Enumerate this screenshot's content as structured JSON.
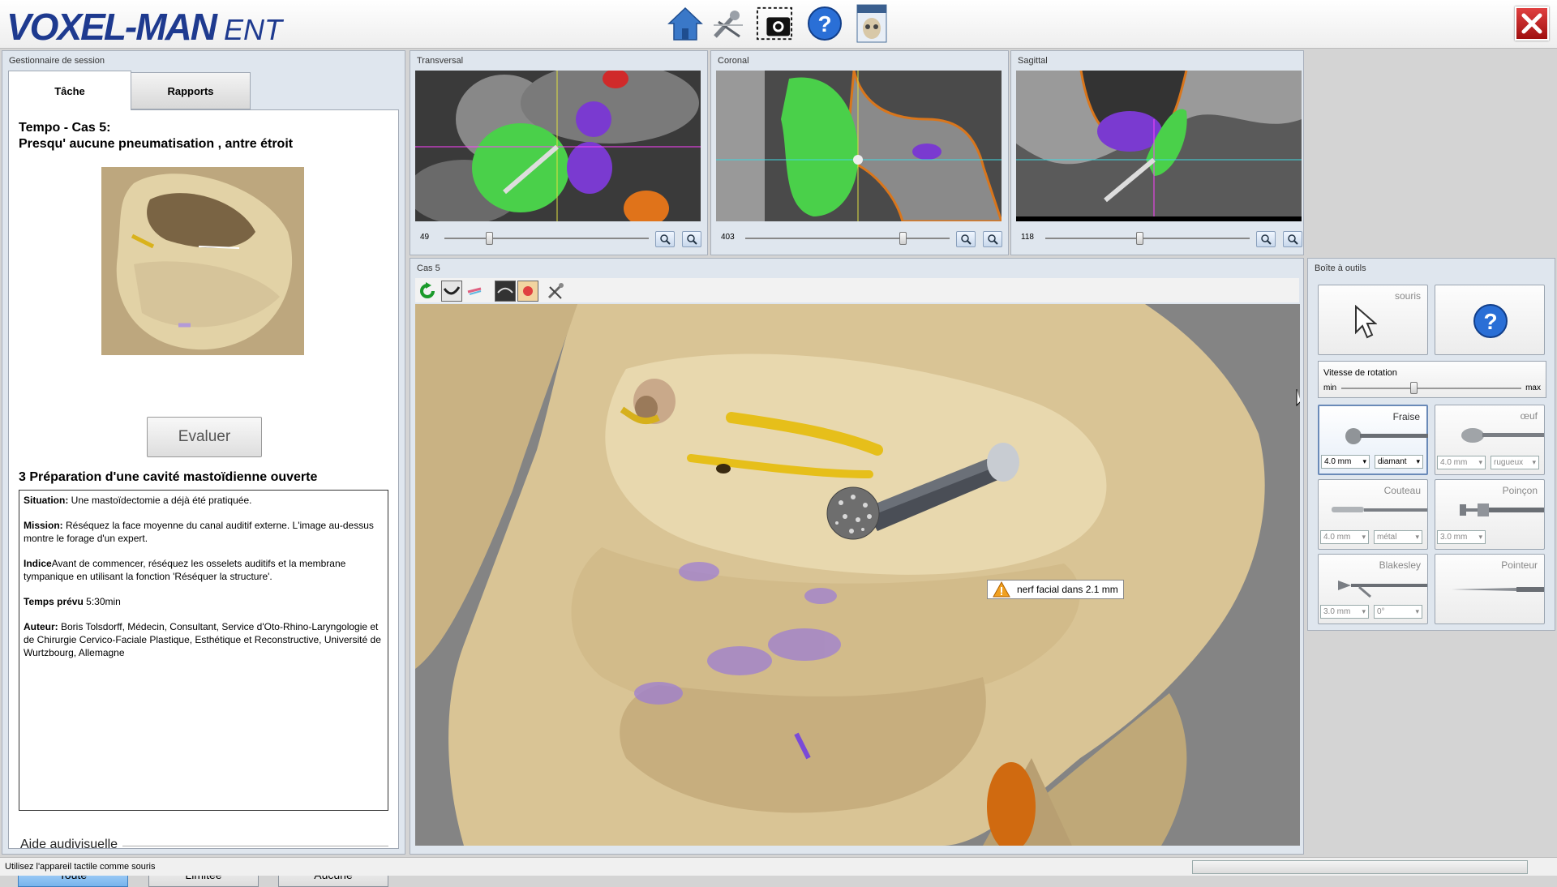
{
  "app": {
    "brand": "VOXEL-MAN",
    "product": "ENT"
  },
  "topbar": {
    "icons": [
      "home-icon",
      "tools-icon",
      "screenshot-icon",
      "help-icon",
      "atlas-icon"
    ],
    "close": "close-icon"
  },
  "session": {
    "title": "Gestionnaire de session",
    "tabs": [
      "Tâche",
      "Rapports"
    ],
    "task_line1": "Tempo - Cas 5:",
    "task_line2": "Presqu' aucune pneumatisation , antre étroit",
    "evaluate": "Evaluer",
    "section": "3 Préparation d'une cavité mastoïdienne ouverte",
    "desc": {
      "situation_label": "Situation:",
      "situation": " Une mastoïdectomie a déjà été pratiquée.",
      "mission_label": "Mission:",
      "mission": " Réséquez la face moyenne du canal auditif externe. L'image au-dessus montre le forage d'un expert.",
      "indice_label": "Indice",
      "indice": "Avant de commencer, réséquez les osselets auditifs et la membrane tympanique en utilisant la fonction 'Réséquer la structure'.",
      "temps_label": "Temps prévu",
      "temps": " 5:30min",
      "auteur_label": "Auteur:",
      "auteur": " Boris Tolsdorff, Médecin, Consultant, Service d'Oto-Rhino-Laryngologie et de Chirurgie Cervico-Faciale Plastique, Esthétique et Reconstructive, Université de Wurtzbourg, Allemagne"
    },
    "aide": "Aide audivisuelle",
    "aide_buttons": [
      "Toute",
      "Limitée",
      "Aucune"
    ]
  },
  "slices": [
    {
      "title": "Transversal",
      "value": "49",
      "slider": 0.22
    },
    {
      "title": "Coronal",
      "value": "403",
      "slider": 0.77
    },
    {
      "title": "Sagittal",
      "value": "118",
      "slider": 0.46
    }
  ],
  "view3d": {
    "title": "Cas 5",
    "toolbar": [
      "rotate-icon",
      "view-icon",
      "color-icon",
      "layer-icon",
      "highlight-icon",
      "instrument-icon"
    ],
    "warning": "nerf facial dans 2.1 mm"
  },
  "toolbox": {
    "title": "Boîte à outils",
    "mouse": "souris",
    "rotation_label": "Vitesse de rotation",
    "rotation_min": "min",
    "rotation_max": "max",
    "rotation_value": 0.4,
    "tools": [
      {
        "name": "Fraise",
        "size": "4.0 mm",
        "type": "diamant"
      },
      {
        "name": "œuf",
        "size": "4.0 mm",
        "type": "rugueux"
      },
      {
        "name": "Couteau",
        "size": "4.0 mm",
        "type": "métal"
      },
      {
        "name": "Poinçon",
        "size": "3.0 mm"
      },
      {
        "name": "Blakesley",
        "size": "3.0 mm",
        "type": "0°"
      },
      {
        "name": "Pointeur"
      }
    ]
  },
  "status": {
    "text": "Utilisez l'appareil tactile comme souris"
  }
}
